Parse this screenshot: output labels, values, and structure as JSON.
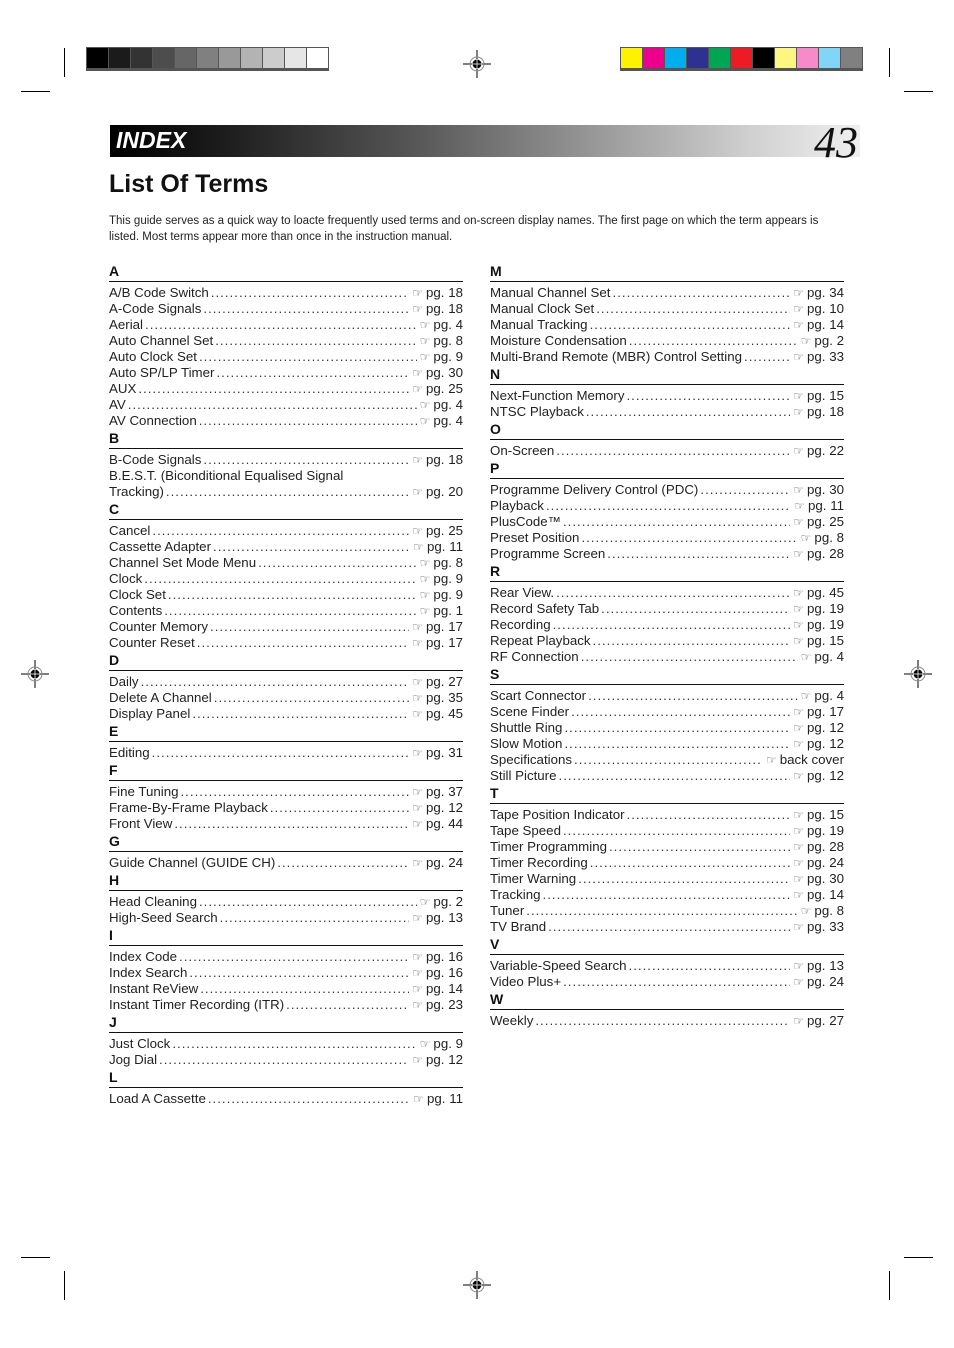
{
  "calibration": {
    "grayscale": [
      "#000000",
      "#1b1b1b",
      "#333333",
      "#4d4d4d",
      "#666666",
      "#808080",
      "#999999",
      "#b3b3b3",
      "#cccccc",
      "#e6e6e6",
      "#ffffff"
    ],
    "colors": [
      "#fff200",
      "#ec008c",
      "#00aeef",
      "#2e3192",
      "#00a651",
      "#ed1c24",
      "#000000",
      "#fff67f",
      "#f68acb",
      "#7fd6f7",
      "#808080"
    ]
  },
  "header": {
    "section_title": "INDEX",
    "page_number": "43"
  },
  "page": {
    "heading": "List Of Terms",
    "intro": "This guide serves as a quick way to loacte frequently used terms and on-screen display names. The first page on which the term appears is listed. Most terms appear more than once in the instruction manual."
  },
  "pointer_icon": "pointing-hand-icon",
  "left_column": [
    {
      "letter": "A",
      "entries": [
        {
          "term": "A/B Code Switch",
          "page": "pg. 18"
        },
        {
          "term": "A-Code Signals",
          "page": "pg. 18"
        },
        {
          "term": "Aerial",
          "page": "pg. 4"
        },
        {
          "term": "Auto Channel Set",
          "page": "pg. 8"
        },
        {
          "term": "Auto Clock Set",
          "page": "pg. 9"
        },
        {
          "term": "Auto SP/LP Timer",
          "page": "pg. 30"
        },
        {
          "term": "AUX",
          "page": "pg. 25"
        },
        {
          "term": "AV",
          "page": "pg. 4"
        },
        {
          "term": "AV Connection",
          "page": "pg. 4"
        }
      ]
    },
    {
      "letter": "B",
      "entries": [
        {
          "term": "B-Code Signals",
          "page": "pg. 18"
        },
        {
          "term": "B.E.S.T. (Biconditional Equalised Signal",
          "page": "",
          "wrap": true
        },
        {
          "term": "Tracking)",
          "page": "pg. 20"
        }
      ]
    },
    {
      "letter": "C",
      "entries": [
        {
          "term": "Cancel",
          "page": "pg. 25"
        },
        {
          "term": "Cassette Adapter",
          "page": "pg. 11"
        },
        {
          "term": "Channel Set Mode Menu",
          "page": "pg. 8"
        },
        {
          "term": "Clock",
          "page": "pg. 9"
        },
        {
          "term": "Clock Set",
          "page": "pg. 9"
        },
        {
          "term": "Contents",
          "page": "pg. 1"
        },
        {
          "term": "Counter Memory",
          "page": "pg. 17"
        },
        {
          "term": "Counter Reset",
          "page": "pg. 17"
        }
      ]
    },
    {
      "letter": "D",
      "entries": [
        {
          "term": "Daily",
          "page": "pg. 27"
        },
        {
          "term": "Delete A Channel",
          "page": "pg. 35"
        },
        {
          "term": "Display Panel",
          "page": "pg. 45"
        }
      ]
    },
    {
      "letter": "E",
      "entries": [
        {
          "term": "Editing",
          "page": "pg. 31"
        }
      ]
    },
    {
      "letter": "F",
      "entries": [
        {
          "term": "Fine Tuning",
          "page": "pg. 37"
        },
        {
          "term": "Frame-By-Frame Playback",
          "page": "pg. 12"
        },
        {
          "term": "Front View",
          "page": "pg. 44"
        }
      ]
    },
    {
      "letter": "G",
      "entries": [
        {
          "term": "Guide Channel (GUIDE CH)",
          "page": "pg. 24"
        }
      ]
    },
    {
      "letter": "H",
      "entries": [
        {
          "term": "Head Cleaning",
          "page": "pg. 2"
        },
        {
          "term": "High-Seed Search",
          "page": "pg. 13"
        }
      ]
    },
    {
      "letter": "I",
      "entries": [
        {
          "term": "Index Code",
          "page": "pg. 16"
        },
        {
          "term": "Index Search",
          "page": "pg. 16"
        },
        {
          "term": "Instant ReView",
          "page": "pg. 14"
        },
        {
          "term": "Instant Timer Recording (ITR)",
          "page": "pg. 23"
        }
      ]
    },
    {
      "letter": "J",
      "entries": [
        {
          "term": "Just Clock",
          "page": "pg. 9"
        },
        {
          "term": "Jog Dial",
          "page": "pg. 12"
        }
      ]
    },
    {
      "letter": "L",
      "entries": [
        {
          "term": "Load A Cassette",
          "page": "pg. 11"
        }
      ]
    }
  ],
  "right_column": [
    {
      "letter": "M",
      "entries": [
        {
          "term": "Manual Channel Set",
          "page": "pg. 34"
        },
        {
          "term": "Manual Clock Set",
          "page": "pg. 10"
        },
        {
          "term": "Manual Tracking",
          "page": "pg. 14"
        },
        {
          "term": "Moisture Condensation",
          "page": "pg. 2"
        },
        {
          "term": "Multi-Brand Remote (MBR) Control Setting",
          "page": "pg. 33"
        }
      ]
    },
    {
      "letter": "N",
      "entries": [
        {
          "term": "Next-Function Memory",
          "page": "pg. 15"
        },
        {
          "term": "NTSC Playback",
          "page": "pg. 18"
        }
      ]
    },
    {
      "letter": "O",
      "entries": [
        {
          "term": "On-Screen",
          "page": "pg. 22"
        }
      ]
    },
    {
      "letter": "P",
      "entries": [
        {
          "term": "Programme Delivery Control (PDC)",
          "page": "pg. 30"
        },
        {
          "term": "Playback",
          "page": "pg. 11"
        },
        {
          "term": "PlusCode™",
          "page": "pg. 25"
        },
        {
          "term": "Preset Position",
          "page": "pg. 8"
        },
        {
          "term": "Programme Screen",
          "page": "pg. 28"
        }
      ]
    },
    {
      "letter": "R",
      "entries": [
        {
          "term": "Rear View.",
          "page": "pg. 45"
        },
        {
          "term": "Record Safety Tab",
          "page": "pg. 19"
        },
        {
          "term": "Recording",
          "page": "pg. 19"
        },
        {
          "term": "Repeat Playback",
          "page": "pg. 15"
        },
        {
          "term": "RF Connection",
          "page": "pg. 4"
        }
      ]
    },
    {
      "letter": "S",
      "entries": [
        {
          "term": "Scart Connector",
          "page": "pg. 4"
        },
        {
          "term": "Scene Finder",
          "page": "pg. 17"
        },
        {
          "term": "Shuttle Ring",
          "page": "pg. 12"
        },
        {
          "term": "Slow Motion",
          "page": "pg. 12"
        },
        {
          "term": "Specifications",
          "page": "back cover"
        },
        {
          "term": "Still Picture",
          "page": "pg. 12"
        }
      ]
    },
    {
      "letter": "T",
      "entries": [
        {
          "term": "Tape Position Indicator",
          "page": "pg. 15"
        },
        {
          "term": "Tape Speed",
          "page": "pg. 19"
        },
        {
          "term": "Timer Programming",
          "page": "pg. 28"
        },
        {
          "term": "Timer Recording",
          "page": "pg. 24"
        },
        {
          "term": "Timer Warning",
          "page": "pg. 30"
        },
        {
          "term": "Tracking",
          "page": "pg. 14"
        },
        {
          "term": "Tuner",
          "page": "pg. 8"
        },
        {
          "term": "TV Brand",
          "page": "pg. 33"
        }
      ]
    },
    {
      "letter": "V",
      "entries": [
        {
          "term": "Variable-Speed Search",
          "page": "pg. 13"
        },
        {
          "term": "Video Plus+",
          "page": "pg. 24"
        }
      ]
    },
    {
      "letter": "W",
      "entries": [
        {
          "term": "Weekly",
          "page": "pg. 27"
        }
      ]
    }
  ]
}
